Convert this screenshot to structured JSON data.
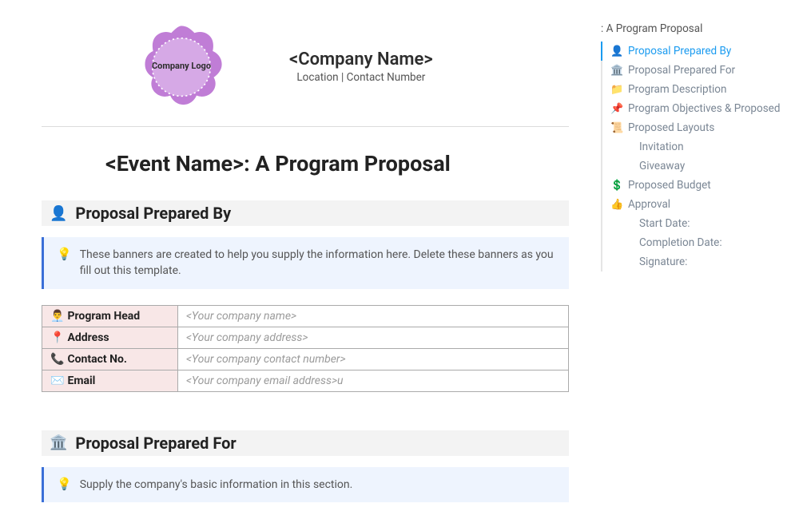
{
  "header": {
    "logo_text": "Company Logo",
    "company_name": "<Company Name>",
    "location_contact": "Location | Contact Number"
  },
  "doc_title": "<Event Name>: A Program Proposal",
  "section1": {
    "icon": "👤",
    "title": "Proposal Prepared By",
    "callout_icon": "💡",
    "callout_text": "These banners are created to help you supply the information here. Delete these banners as you fill out this template.",
    "rows": [
      {
        "icon": "👨‍💼",
        "label": "Program Head",
        "value": "<Your company name>"
      },
      {
        "icon": "📍",
        "label": "Address",
        "value": "<Your company address>"
      },
      {
        "icon": "📞",
        "label": "Contact No.",
        "value": "<Your company contact number>"
      },
      {
        "icon": "✉️",
        "label": "Email",
        "value": "<Your company email address>u"
      }
    ]
  },
  "section2": {
    "icon": "🏛️",
    "title": "Proposal Prepared For",
    "callout_icon": "💡",
    "callout_text": "Supply the company's basic information in this section."
  },
  "outline": {
    "title": ": A Program Proposal",
    "items": [
      {
        "icon": "👤",
        "label": "Proposal Prepared By",
        "active": true,
        "level": 1
      },
      {
        "icon": "🏛️",
        "label": "Proposal Prepared For",
        "active": false,
        "level": 1
      },
      {
        "icon": "📁",
        "label": "Program Description",
        "active": false,
        "level": 1
      },
      {
        "icon": "📌",
        "label": "Program Objectives & Proposed S…",
        "active": false,
        "level": 1
      },
      {
        "icon": "📜",
        "label": "Proposed Layouts",
        "active": false,
        "level": 1
      },
      {
        "icon": "",
        "label": "Invitation",
        "active": false,
        "level": 2
      },
      {
        "icon": "",
        "label": "Giveaway",
        "active": false,
        "level": 2
      },
      {
        "icon": "💲",
        "label": "Proposed Budget",
        "active": false,
        "level": 1
      },
      {
        "icon": "👍",
        "label": "Approval",
        "active": false,
        "level": 1
      },
      {
        "icon": "",
        "label": "Start Date:",
        "active": false,
        "level": 2
      },
      {
        "icon": "",
        "label": "Completion Date:",
        "active": false,
        "level": 2
      },
      {
        "icon": "",
        "label": "Signature:",
        "active": false,
        "level": 2
      }
    ]
  }
}
